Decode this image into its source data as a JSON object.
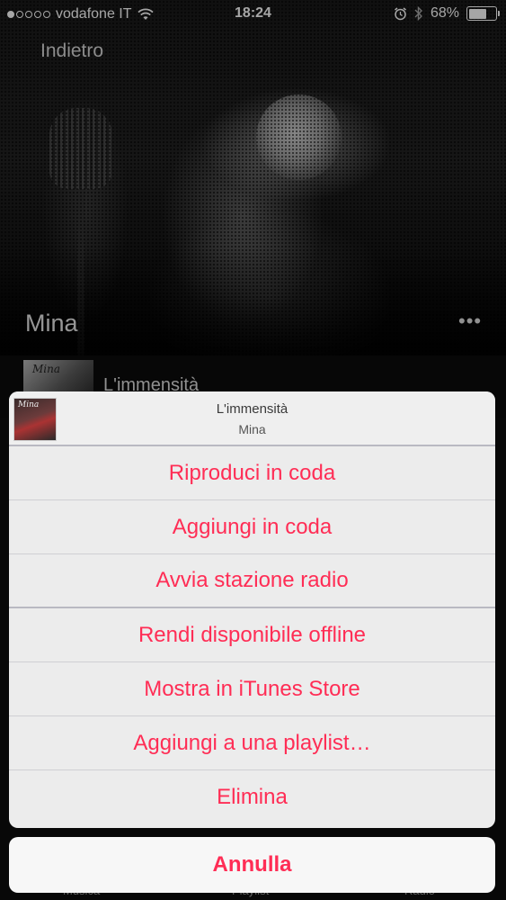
{
  "status_bar": {
    "carrier": "vodafone IT",
    "time": "18:24",
    "battery": "68%",
    "battery_level": 0.68,
    "signal_bars_filled": 1,
    "signal_bars_total": 5
  },
  "nav": {
    "back_label": "Indietro"
  },
  "artist": {
    "name": "Mina",
    "more_label": "•••"
  },
  "song_row": {
    "title": "L'immensità",
    "thumb_text": "Mina"
  },
  "action_sheet": {
    "title": "L'immensità",
    "subtitle": "Mina",
    "thumb_text": "Mina",
    "groups": [
      [
        "Riproduci in coda",
        "Aggiungi in coda",
        "Avvia stazione radio"
      ],
      [
        "Rendi disponibile offline",
        "Mostra in iTunes Store",
        "Aggiungi a una playlist…",
        "Elimina"
      ]
    ],
    "cancel_label": "Annulla"
  },
  "tab_bar": {
    "items": [
      "Musica",
      "Playlist",
      "Radio"
    ]
  },
  "colors": {
    "accent": "#ff2d55",
    "sheet_bg": "#ececec"
  }
}
